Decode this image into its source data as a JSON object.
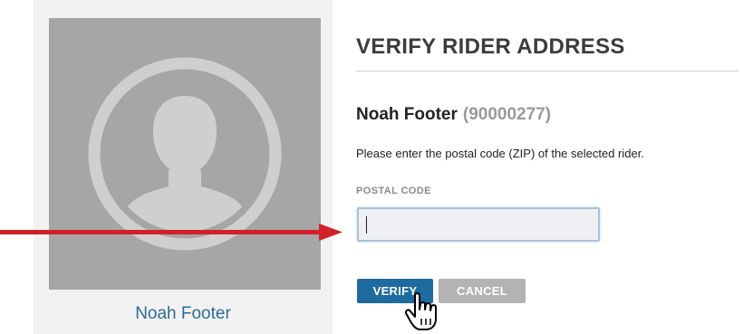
{
  "profile": {
    "name": "Noah Footer"
  },
  "form": {
    "title": "VERIFY RIDER ADDRESS",
    "rider_name": "Noah Footer",
    "rider_id": "(90000277)",
    "instructions": "Please enter the postal code (ZIP) of the selected rider.",
    "postal_label": "POSTAL CODE",
    "postal_value": "",
    "verify_label": "VERIFY",
    "cancel_label": "CANCEL"
  },
  "colors": {
    "accent_blue": "#1f6a9e",
    "name_link_blue": "#2e6b96",
    "annotation_red": "#d0212a",
    "cancel_gray": "#b3b3b3",
    "avatar_gray": "#a6a6a6"
  },
  "icons": {
    "avatar": "person-silhouette-icon",
    "cursor": "hand-pointer-icon",
    "annotation": "arrow-right-icon"
  }
}
